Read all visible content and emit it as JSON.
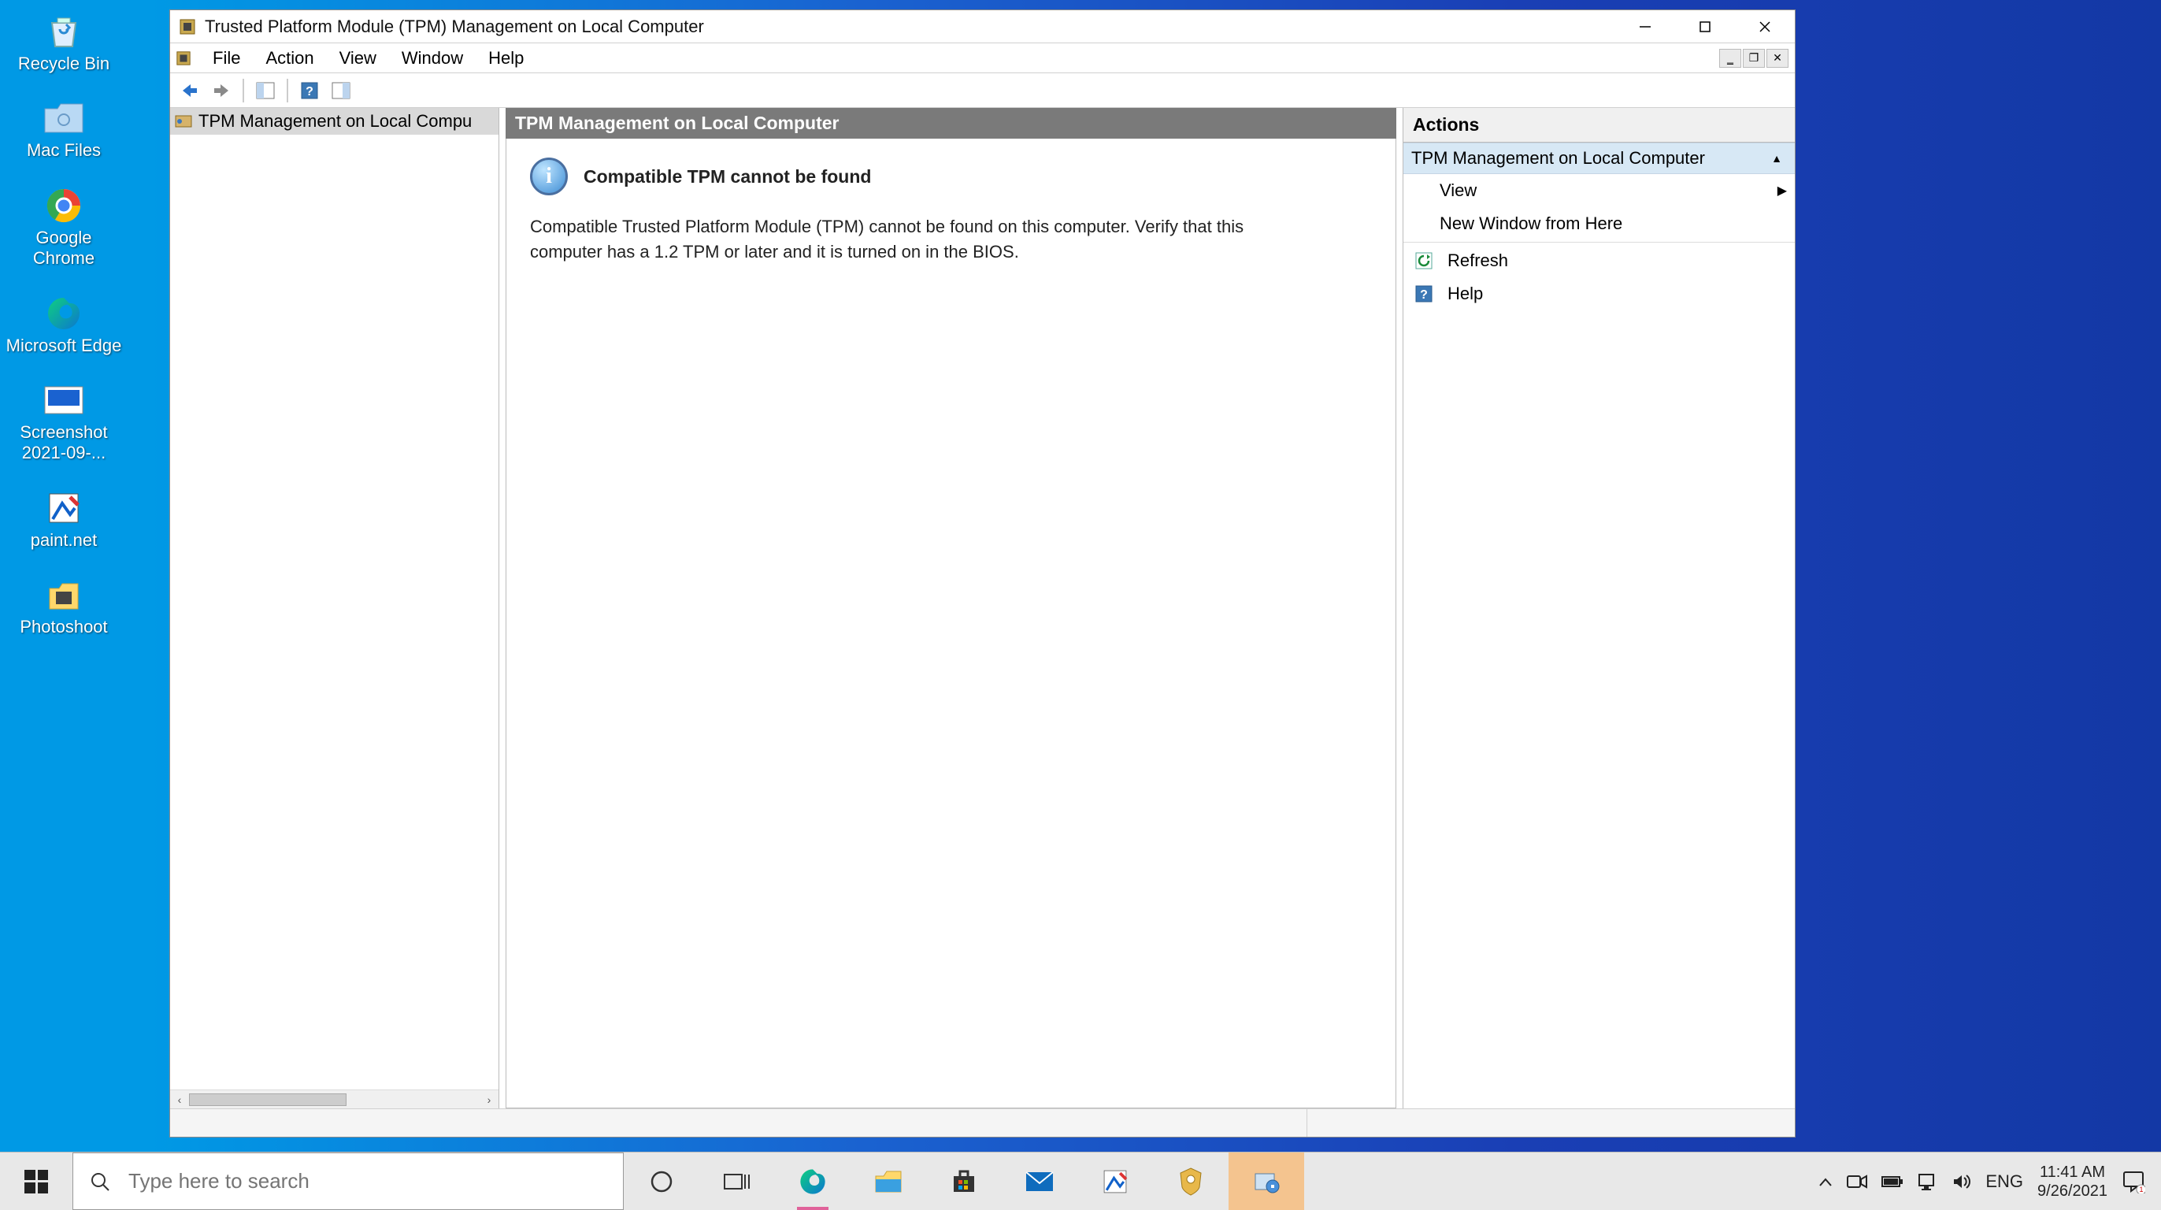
{
  "desktop": {
    "icons": [
      {
        "name": "recycle-bin",
        "label": "Recycle Bin"
      },
      {
        "name": "mac-files",
        "label": "Mac Files"
      },
      {
        "name": "google-chrome",
        "label": "Google Chrome"
      },
      {
        "name": "microsoft-edge",
        "label": "Microsoft Edge"
      },
      {
        "name": "screenshot",
        "label": "Screenshot 2021-09-..."
      },
      {
        "name": "paintnet",
        "label": "paint.net"
      },
      {
        "name": "photoshoot",
        "label": "Photoshoot"
      }
    ]
  },
  "window": {
    "title": "Trusted Platform Module (TPM) Management on Local Computer",
    "menus": [
      "File",
      "Action",
      "View",
      "Window",
      "Help"
    ],
    "tree": {
      "root": "TPM Management on Local Compu"
    },
    "center": {
      "header": "TPM Management on Local Computer",
      "info_title": "Compatible TPM cannot be found",
      "info_desc": "Compatible Trusted Platform Module (TPM) cannot be found on this computer. Verify that this computer has a 1.2 TPM or later and it is turned on in the BIOS."
    },
    "actions": {
      "header": "Actions",
      "section": "TPM Management on Local Computer",
      "items": {
        "view": "View",
        "new_window": "New Window from Here",
        "refresh": "Refresh",
        "help": "Help"
      }
    }
  },
  "taskbar": {
    "search_placeholder": "Type here to search",
    "lang": "ENG",
    "time": "11:41 AM",
    "date": "9/26/2021"
  }
}
